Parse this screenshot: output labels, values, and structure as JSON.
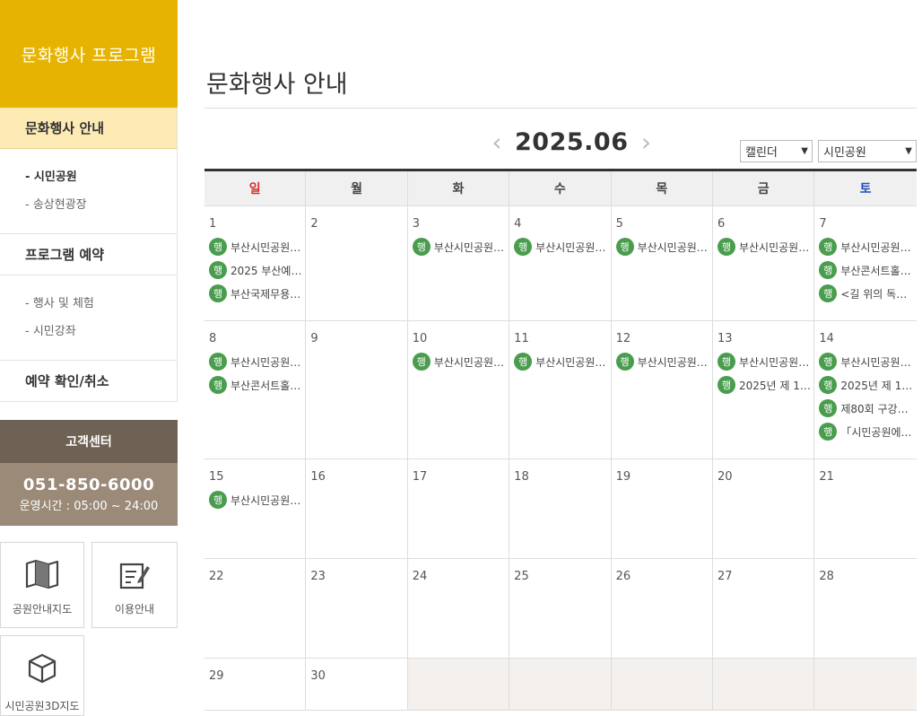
{
  "sidebar": {
    "title": "문화행사 프로그램",
    "sections": [
      {
        "label": "문화행사 안내",
        "items": [
          "- 시민공원",
          "- 송상현광장"
        ]
      },
      {
        "label": "프로그램 예약",
        "items": [
          "- 행사 및 체험",
          "- 시민강좌"
        ]
      },
      {
        "label": "예약 확인/취소"
      }
    ],
    "customer_center": {
      "title": "고객센터",
      "phone": "051-850-6000",
      "hours": "운영시간 : 05:00 ~ 24:00"
    },
    "quick_links": [
      {
        "label": "공원안내지도",
        "icon": "map-icon"
      },
      {
        "label": "이용안내",
        "icon": "document-edit-icon"
      },
      {
        "label": "시민공원3D지도",
        "icon": "cube-icon"
      }
    ]
  },
  "main": {
    "title": "문화행사 안내",
    "month": "2025.06",
    "prev_arrow": "‹",
    "next_arrow": "›",
    "view_select": "캘린더",
    "place_select": "시민공원",
    "weekdays": [
      "일",
      "월",
      "화",
      "수",
      "목",
      "금",
      "토"
    ],
    "event_badge": "행",
    "weeks": [
      [
        {
          "day": "1",
          "events": [
            "부산시민공원…",
            "2025 부산예…",
            "부산국제무용…"
          ]
        },
        {
          "day": "2",
          "events": []
        },
        {
          "day": "3",
          "events": [
            "부산시민공원…"
          ]
        },
        {
          "day": "4",
          "events": [
            "부산시민공원…"
          ]
        },
        {
          "day": "5",
          "events": [
            "부산시민공원…"
          ]
        },
        {
          "day": "6",
          "events": [
            "부산시민공원…"
          ]
        },
        {
          "day": "7",
          "events": [
            "부산시민공원…",
            "부산콘서트홀…",
            "<길 위의 독…"
          ]
        }
      ],
      [
        {
          "day": "8",
          "events": [
            "부산시민공원…",
            "부산콘서트홀…"
          ]
        },
        {
          "day": "9",
          "events": []
        },
        {
          "day": "10",
          "events": [
            "부산시민공원…"
          ]
        },
        {
          "day": "11",
          "events": [
            "부산시민공원…"
          ]
        },
        {
          "day": "12",
          "events": [
            "부산시민공원…"
          ]
        },
        {
          "day": "13",
          "events": [
            "부산시민공원…",
            "2025년 제 1…"
          ]
        },
        {
          "day": "14",
          "events": [
            "부산시민공원…",
            "2025년 제 1…",
            "제80회 구강…",
            "「시민공원에…"
          ]
        }
      ],
      [
        {
          "day": "15",
          "events": [
            "부산시민공원…"
          ]
        },
        {
          "day": "16",
          "events": []
        },
        {
          "day": "17",
          "events": []
        },
        {
          "day": "18",
          "events": []
        },
        {
          "day": "19",
          "events": []
        },
        {
          "day": "20",
          "events": []
        },
        {
          "day": "21",
          "events": []
        }
      ],
      [
        {
          "day": "22",
          "events": []
        },
        {
          "day": "23",
          "events": []
        },
        {
          "day": "24",
          "events": []
        },
        {
          "day": "25",
          "events": []
        },
        {
          "day": "26",
          "events": []
        },
        {
          "day": "27",
          "events": []
        },
        {
          "day": "28",
          "events": []
        }
      ],
      [
        {
          "day": "29",
          "events": []
        },
        {
          "day": "30",
          "events": []
        },
        {
          "day": "",
          "events": []
        },
        {
          "day": "",
          "events": []
        },
        {
          "day": "",
          "events": []
        },
        {
          "day": "",
          "events": []
        },
        {
          "day": "",
          "events": []
        }
      ]
    ]
  },
  "colors": {
    "accent": "#e6b400",
    "active_bg": "#fdeab4",
    "sunday": "#d32f2f",
    "saturday": "#1e4fc2",
    "badge": "#4a9d4e",
    "cs_head": "#6e6254",
    "cs_body": "#9a8a77"
  }
}
